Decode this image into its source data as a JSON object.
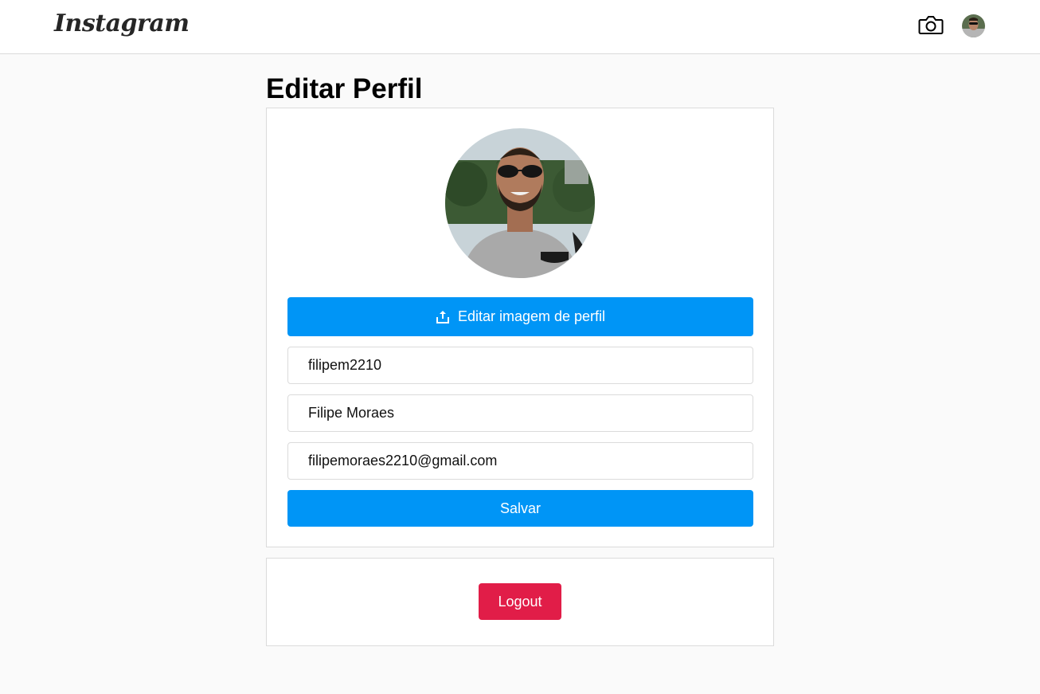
{
  "header": {
    "logo_text": "Instagram",
    "camera_icon": "camera-icon",
    "avatar_icon": "user-avatar"
  },
  "page": {
    "title": "Editar Perfil"
  },
  "profile_form": {
    "upload_button_label": "Editar imagem de perfil",
    "upload_icon": "upload-icon",
    "username_value": "filipem2210",
    "name_value": "Filipe Moraes",
    "email_value": "filipemoraes2210@gmail.com",
    "save_button_label": "Salvar"
  },
  "logout": {
    "button_label": "Logout"
  },
  "colors": {
    "primary_blue": "#0095f6",
    "logout_red": "#e11d48",
    "background": "#fafafa",
    "border": "#dbdbdb"
  }
}
